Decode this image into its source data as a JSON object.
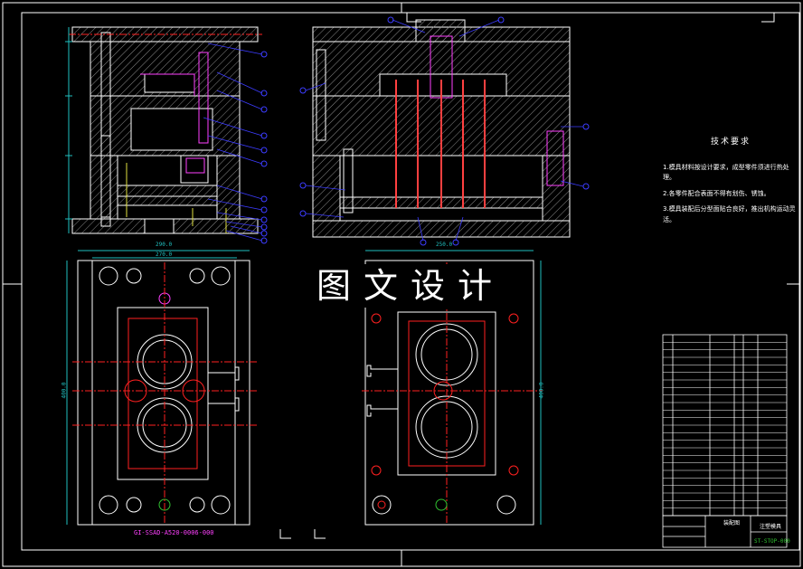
{
  "watermark": "图文设计",
  "tech_requirements": {
    "title": "技术要求",
    "lines": [
      "1.模具材料按设计要求，成型零件须进行热处理。",
      "2.各零件配合表面不得有划伤、锈蚀。",
      "3.模具装配后分型面贴合良好，推出机构运动灵活。"
    ]
  },
  "drawing_number": "GI-SSAD-A520-0006-000",
  "title_block": {
    "name": "注塑模具",
    "code": "ST-STOP-000",
    "part": "装配图"
  },
  "dimensions": {
    "left_top": [
      "290.0",
      "270.0"
    ],
    "right_top": "250.0",
    "left_side": "400.0",
    "right_side": "400.0"
  },
  "colors": {
    "outline": "#ffffff",
    "hatch": "#9a9a9a",
    "balloon": "#3c3cff",
    "center": "#ff2020",
    "dim": "#20c0c0",
    "pin": "#ff4040",
    "magenta": "#ff40ff",
    "green": "#30c030",
    "yellow": "#e0e040"
  }
}
